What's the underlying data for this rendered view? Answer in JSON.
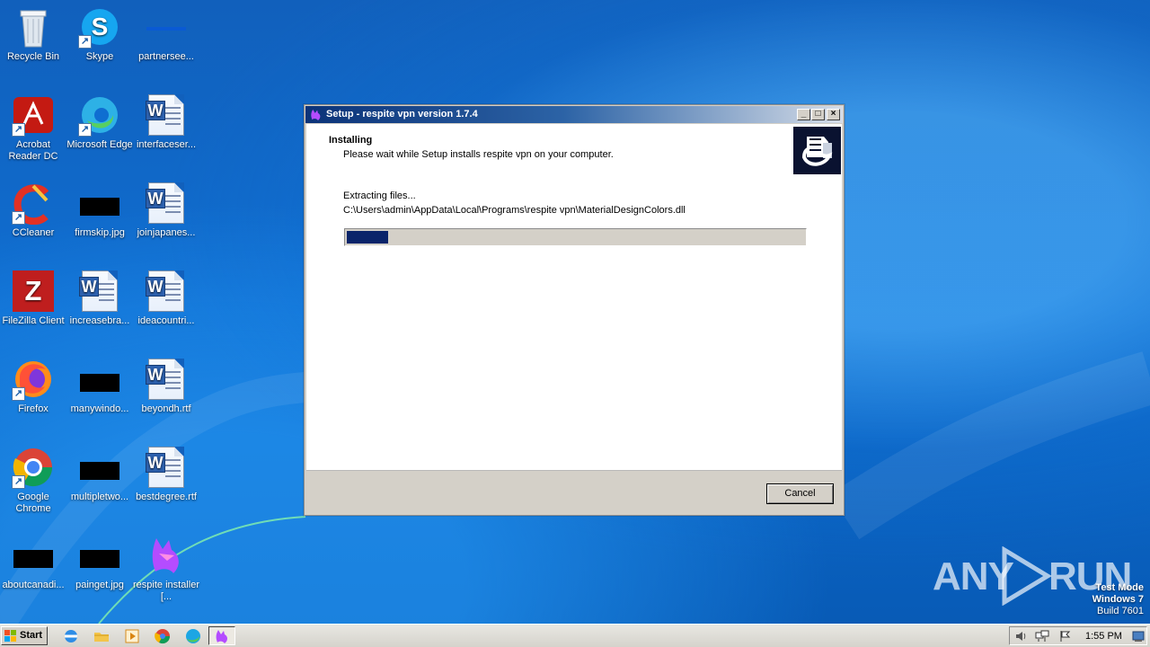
{
  "desktop": {
    "icons": [
      {
        "label": "Recycle Bin"
      },
      {
        "label": "Skype"
      },
      {
        "label": "partnersee..."
      },
      {
        "label": "Acrobat Reader DC"
      },
      {
        "label": "Microsoft Edge"
      },
      {
        "label": "interfaceser..."
      },
      {
        "label": "CCleaner"
      },
      {
        "label": "firmskip.jpg"
      },
      {
        "label": "joinjapanes..."
      },
      {
        "label": "FileZilla Client"
      },
      {
        "label": "increasebra..."
      },
      {
        "label": "ideacountri..."
      },
      {
        "label": "Firefox"
      },
      {
        "label": "manywindo..."
      },
      {
        "label": "beyondh.rtf"
      },
      {
        "label": "Google Chrome"
      },
      {
        "label": "multipletwo..."
      },
      {
        "label": "bestdegree.rtf"
      },
      {
        "label": "aboutcanadi..."
      },
      {
        "label": "painget.jpg"
      },
      {
        "label": "respite installer [..."
      }
    ],
    "watermark": {
      "left": "ANY",
      "right": "RUN"
    },
    "test_mode": {
      "line1": "Test Mode",
      "line2": "Windows 7",
      "line3": "Build 7601"
    }
  },
  "setup_window": {
    "title": "Setup - respite vpn version 1.7.4",
    "heading": "Installing",
    "subheading": "Please wait while Setup installs respite vpn on your computer.",
    "status": "Extracting files...",
    "path": "C:\\Users\\admin\\AppData\\Local\\Programs\\respite vpn\\MaterialDesignColors.dll",
    "progress": 0.09,
    "cancel_label": "Cancel"
  },
  "taskbar": {
    "start_label": "Start",
    "time": "1:55 PM"
  },
  "colors": {
    "progress_fill": "#0a246a",
    "title_dark": "#0c3378",
    "desktop_blue": "#0f6ed1"
  }
}
